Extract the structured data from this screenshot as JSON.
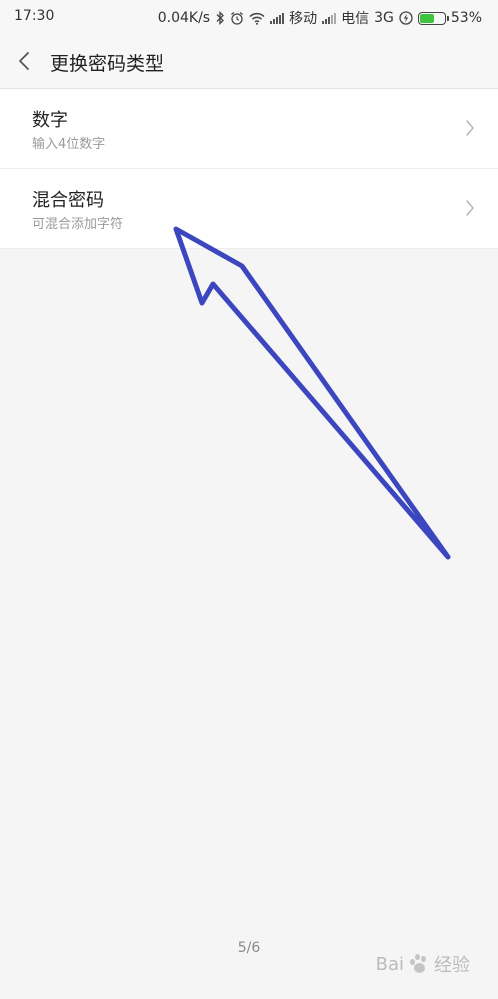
{
  "status_bar": {
    "time": "17:30",
    "net_speed": "0.04K/s",
    "carrier1": "移动",
    "carrier2": "电信",
    "network_type": "3G",
    "battery": "53%",
    "battery_level": 0.53
  },
  "header": {
    "title": "更换密码类型"
  },
  "options": [
    {
      "label": "数字",
      "sub": "输入4位数字"
    },
    {
      "label": "混合密码",
      "sub": "可混合添加字符"
    }
  ],
  "pager": "5/6",
  "watermark": {
    "brand": "Bai",
    "suffix": "经验"
  },
  "colors": {
    "accent_arrow": "#3c46bf",
    "background": "#f5f5f5",
    "battery": "#3fc43f"
  }
}
